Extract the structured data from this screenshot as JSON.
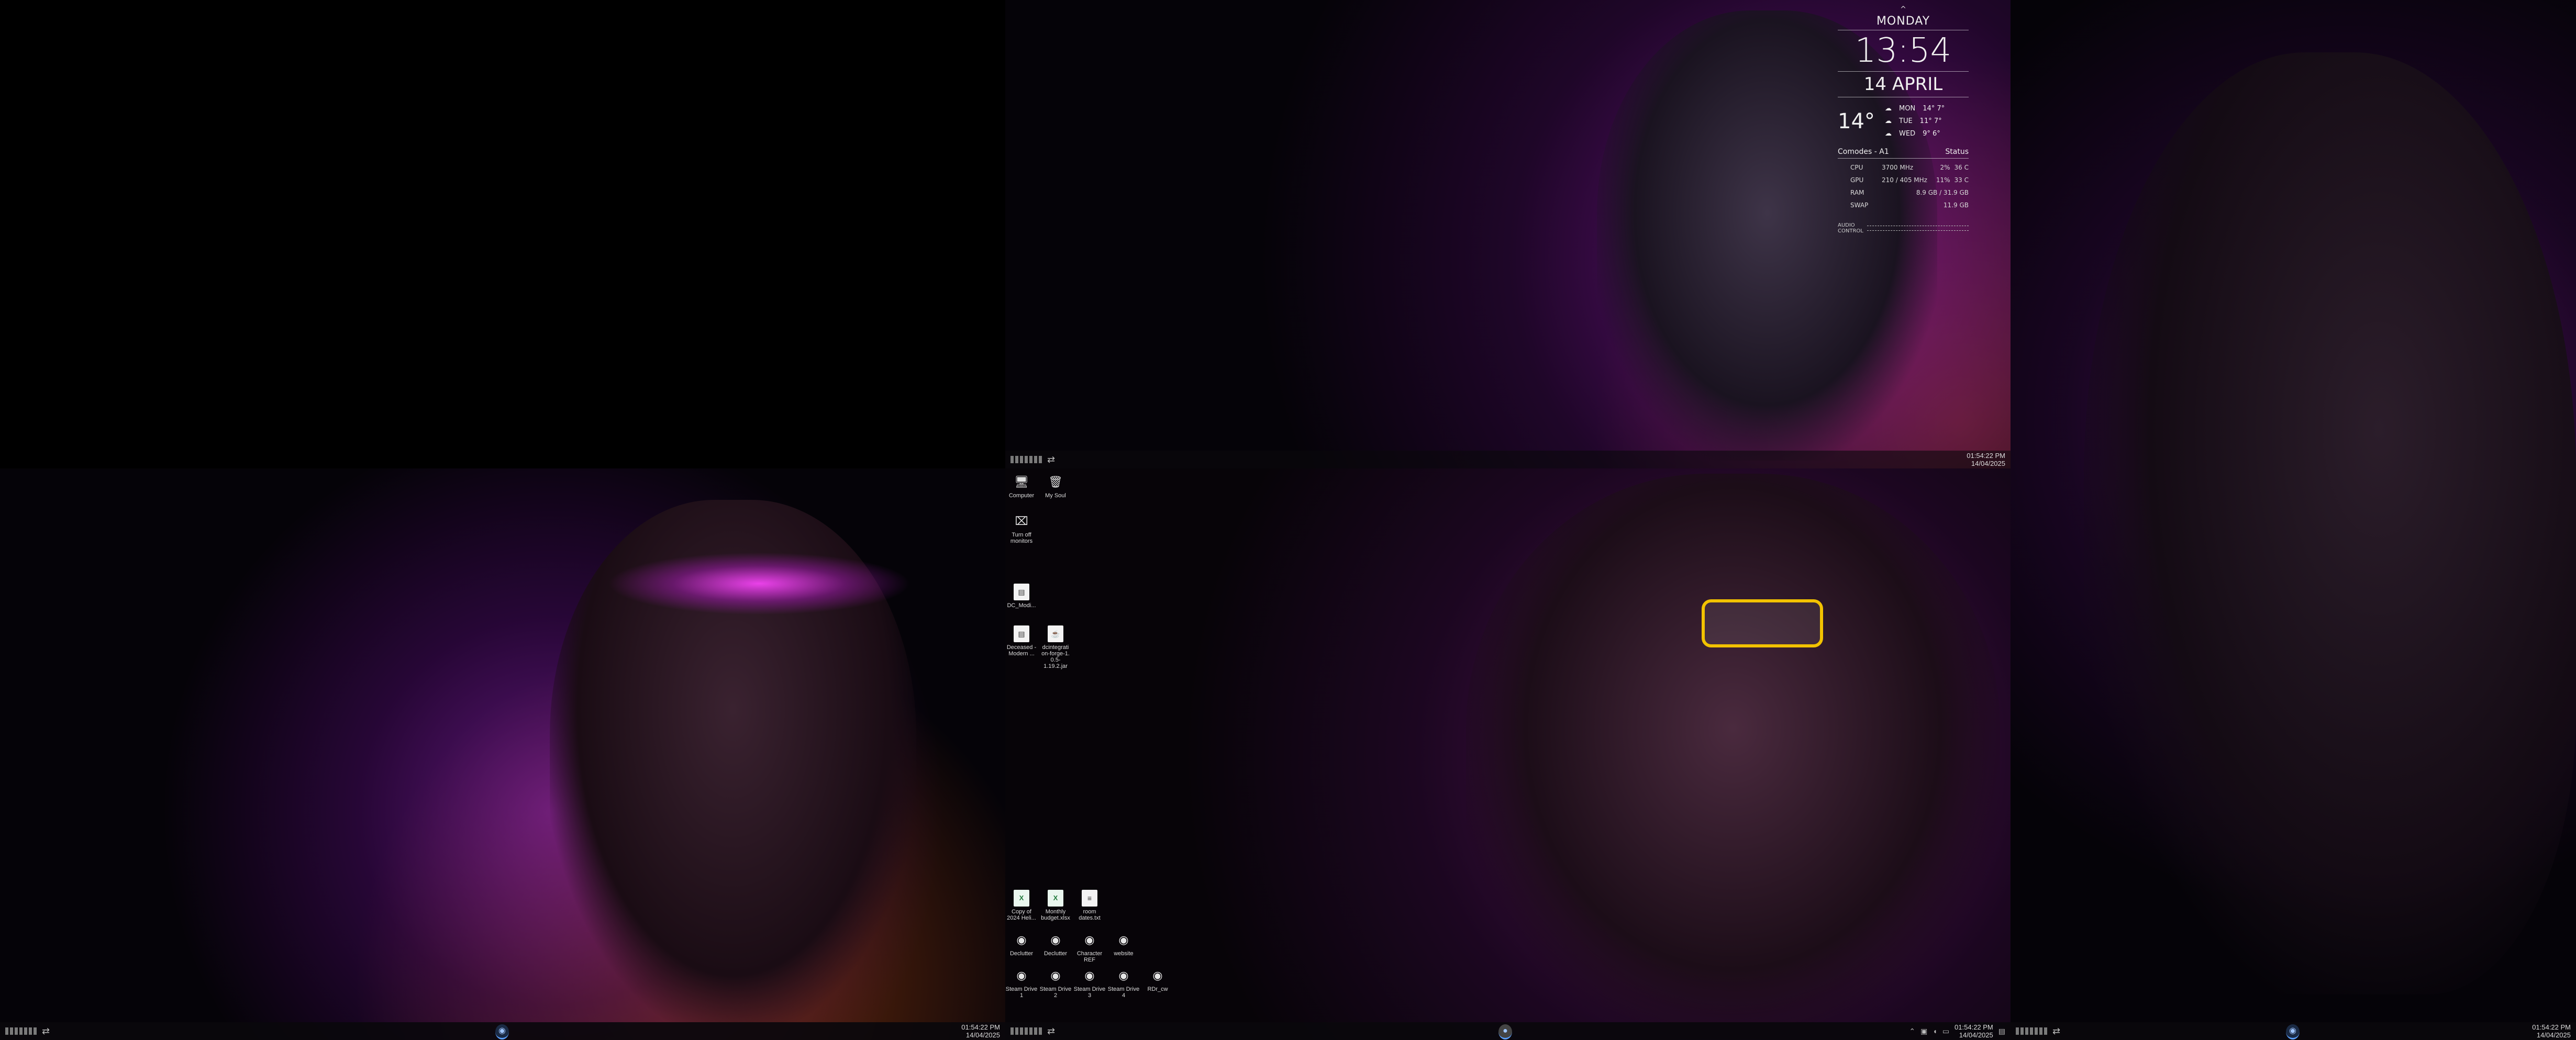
{
  "monitors": {
    "a": {
      "taskbar_time": "01:54:22 PM",
      "taskbar_date": "14/04/2025"
    },
    "b": {
      "taskbar_time": "01:54:22 PM",
      "taskbar_date": "14/04/2025"
    },
    "c": {
      "taskbar_time": "01:54:22 PM",
      "taskbar_date": "14/04/2025"
    },
    "d": {
      "taskbar_time": "01:54:22 PM",
      "taskbar_date": "14/04/2025"
    }
  },
  "desktop_icons": [
    {
      "label": "Computer",
      "icon": "computer-icon"
    },
    {
      "label": "My Soul",
      "icon": "recycle-bin-icon"
    },
    {
      "label": "Turn off monitors",
      "icon": "monitor-off-icon"
    },
    {
      "label": "DC_Modi...",
      "icon": "document-icon"
    },
    {
      "label": "Deceased - Modern ...",
      "icon": "document-icon"
    },
    {
      "label": "dcintegrati on-forge-1. 0.5-1.19.2.jar",
      "icon": "jar-icon"
    },
    {
      "label": "Copy of 2024 Heli...",
      "icon": "spreadsheet-icon"
    },
    {
      "label": "Monthly budget.xlsx",
      "icon": "spreadsheet-icon"
    },
    {
      "label": "room dates.txt",
      "icon": "text-file-icon"
    },
    {
      "label": "Declutter",
      "icon": "steam-icon"
    },
    {
      "label": "Declutter",
      "icon": "steam-icon"
    },
    {
      "label": "Character REF",
      "icon": "steam-icon"
    },
    {
      "label": "website",
      "icon": "steam-icon"
    },
    {
      "label": "Steam Drive 1",
      "icon": "steam-icon"
    },
    {
      "label": "Steam Drive 2",
      "icon": "steam-icon"
    },
    {
      "label": "Steam Drive 3",
      "icon": "steam-icon"
    },
    {
      "label": "Steam Drive 4",
      "icon": "steam-icon"
    },
    {
      "label": "RDr_cw",
      "icon": "steam-icon"
    }
  ],
  "widget": {
    "caret": "^",
    "day": "MONDAY",
    "time": "13:54",
    "date": "14 APRIL",
    "temp": "14°",
    "forecast": [
      {
        "day": "MON",
        "temp": "14° 7°"
      },
      {
        "day": "TUE",
        "temp": "11° 7°"
      },
      {
        "day": "WED",
        "temp": "9° 6°"
      }
    ],
    "system_left": "Comodes - A1",
    "system_right": "Status",
    "rows": [
      {
        "label": "CPU",
        "freq": "3700 MHz",
        "load": "2%",
        "temp": "36 C"
      },
      {
        "label": "GPU",
        "freq": "210 / 405 MHz",
        "load": "11%",
        "temp": "33 C"
      },
      {
        "label": "RAM",
        "freq": "",
        "load": "",
        "temp": "8.9 GB / 31.9 GB"
      },
      {
        "label": "SWAP",
        "freq": "",
        "load": "",
        "temp": "11.9 GB"
      }
    ],
    "audio_label": "AUDIO CONTROL"
  },
  "colors": {
    "accent_magenta": "#e040ff",
    "accent_gold": "#f2c200",
    "fire": "#ff6a1a"
  }
}
